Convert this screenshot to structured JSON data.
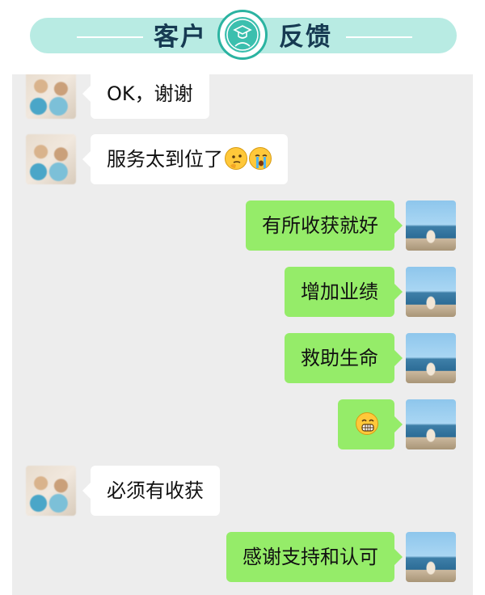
{
  "header": {
    "title_left": "客户",
    "title_right": "反馈",
    "badge_icon": "graduate-badge-icon",
    "accent_color": "#b8ebe3",
    "badge_color": "#3bbfae"
  },
  "chat": {
    "messages": [
      {
        "side": "left",
        "text": "OK，谢谢"
      },
      {
        "side": "left",
        "text": "服务太到位了",
        "emojis": [
          "thinking-face-icon",
          "crying-face-icon"
        ]
      },
      {
        "side": "right",
        "text": "有所收获就好"
      },
      {
        "side": "right",
        "text": "增加业绩"
      },
      {
        "side": "right",
        "text": "救助生命"
      },
      {
        "side": "right",
        "text": "",
        "emojis": [
          "grinning-face-icon"
        ]
      },
      {
        "side": "left",
        "text": "必须有收获"
      },
      {
        "side": "right",
        "text": "感谢支持和认可"
      }
    ],
    "bubble_colors": {
      "left": "#ffffff",
      "right": "#95ec69"
    },
    "background": "#ededed"
  }
}
